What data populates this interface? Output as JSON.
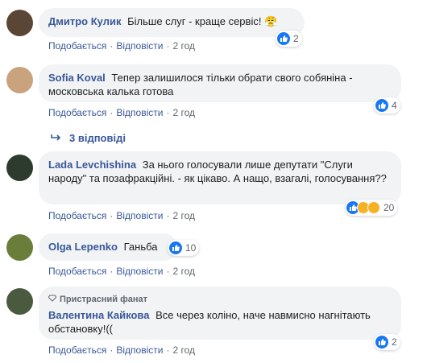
{
  "comments": [
    {
      "author": "Дмитро Кулик",
      "text": "Більше слуг - краще сервіс!",
      "actions": {
        "like": "Подобається",
        "reply": "Відповісти",
        "time": "2 год"
      },
      "reactions": {
        "count": "2"
      }
    },
    {
      "author": "Sofia Koval",
      "text": "Тепер залишилося тільки обрати свого собяніна - московська калька готова",
      "actions": {
        "like": "Подобається",
        "reply": "Відповісти",
        "time": "2 год"
      },
      "reactions": {
        "count": "4"
      },
      "replies_label": "3 відповіді"
    },
    {
      "author": "Lada Levchishina",
      "text": "За нього голосували лише депутати \"Слуги народу\" та позафракційні. - як цікаво. А нащо, взагалі, голосування??",
      "actions": {
        "like": "Подобається",
        "reply": "Відповісти",
        "time": "2 год"
      },
      "reactions": {
        "count": "20"
      }
    },
    {
      "author": "Olga Lepenko",
      "text": "Ганьба",
      "actions": {
        "like": "Подобається",
        "reply": "Відповісти",
        "time": "2 год"
      },
      "reactions": {
        "count": "10"
      }
    },
    {
      "author": "Валентина Кайкова",
      "badge": "Пристрасний фанат",
      "text": "Все через коліно, наче навмисно нагнітають обстановку!((",
      "actions": {
        "like": "Подобається",
        "reply": "Відповісти",
        "time": "2 год"
      },
      "reactions": {
        "count": "2"
      }
    }
  ],
  "colors": {
    "link": "#385898",
    "bubble": "#f2f3f5",
    "like": "#1877f2",
    "meta": "#606770"
  }
}
